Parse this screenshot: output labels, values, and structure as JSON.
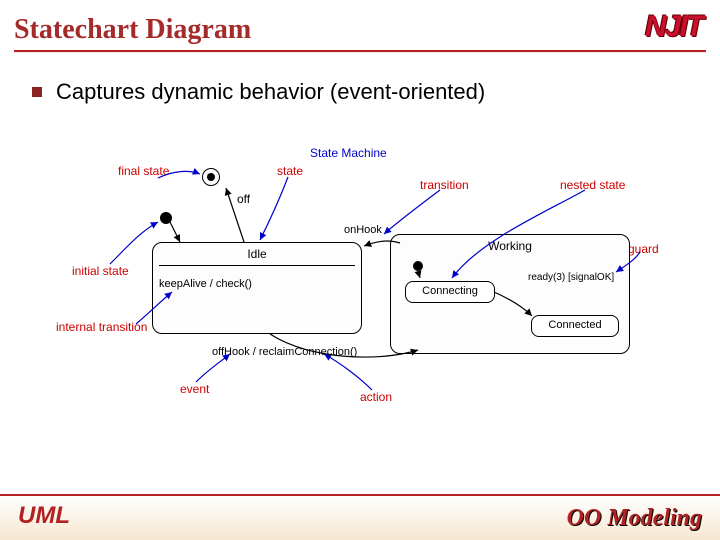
{
  "header": {
    "title": "Statechart Diagram",
    "logo_text": "NJIT"
  },
  "bullets": {
    "main": "Captures dynamic behavior (event-oriented)"
  },
  "diagram": {
    "heading": "State Machine",
    "annotations": {
      "final_state": "final state",
      "state": "state",
      "transition": "transition",
      "nested_state": "nested state",
      "guard": "guard",
      "initial_state": "initial state",
      "internal_transition": "internal transition",
      "event": "event",
      "action": "action"
    },
    "states": {
      "off_label": "off",
      "idle_title": "Idle",
      "idle_internal": "keepAlive / check()",
      "working_title": "Working",
      "connecting": "Connecting",
      "connected": "Connected"
    },
    "transitions": {
      "onHook": "onHook",
      "offHook": "offHook / reclaimConnection()",
      "ready_guard": "ready(3) [signalOK]"
    }
  },
  "footer": {
    "left": "UML",
    "right": "OO Modeling"
  }
}
